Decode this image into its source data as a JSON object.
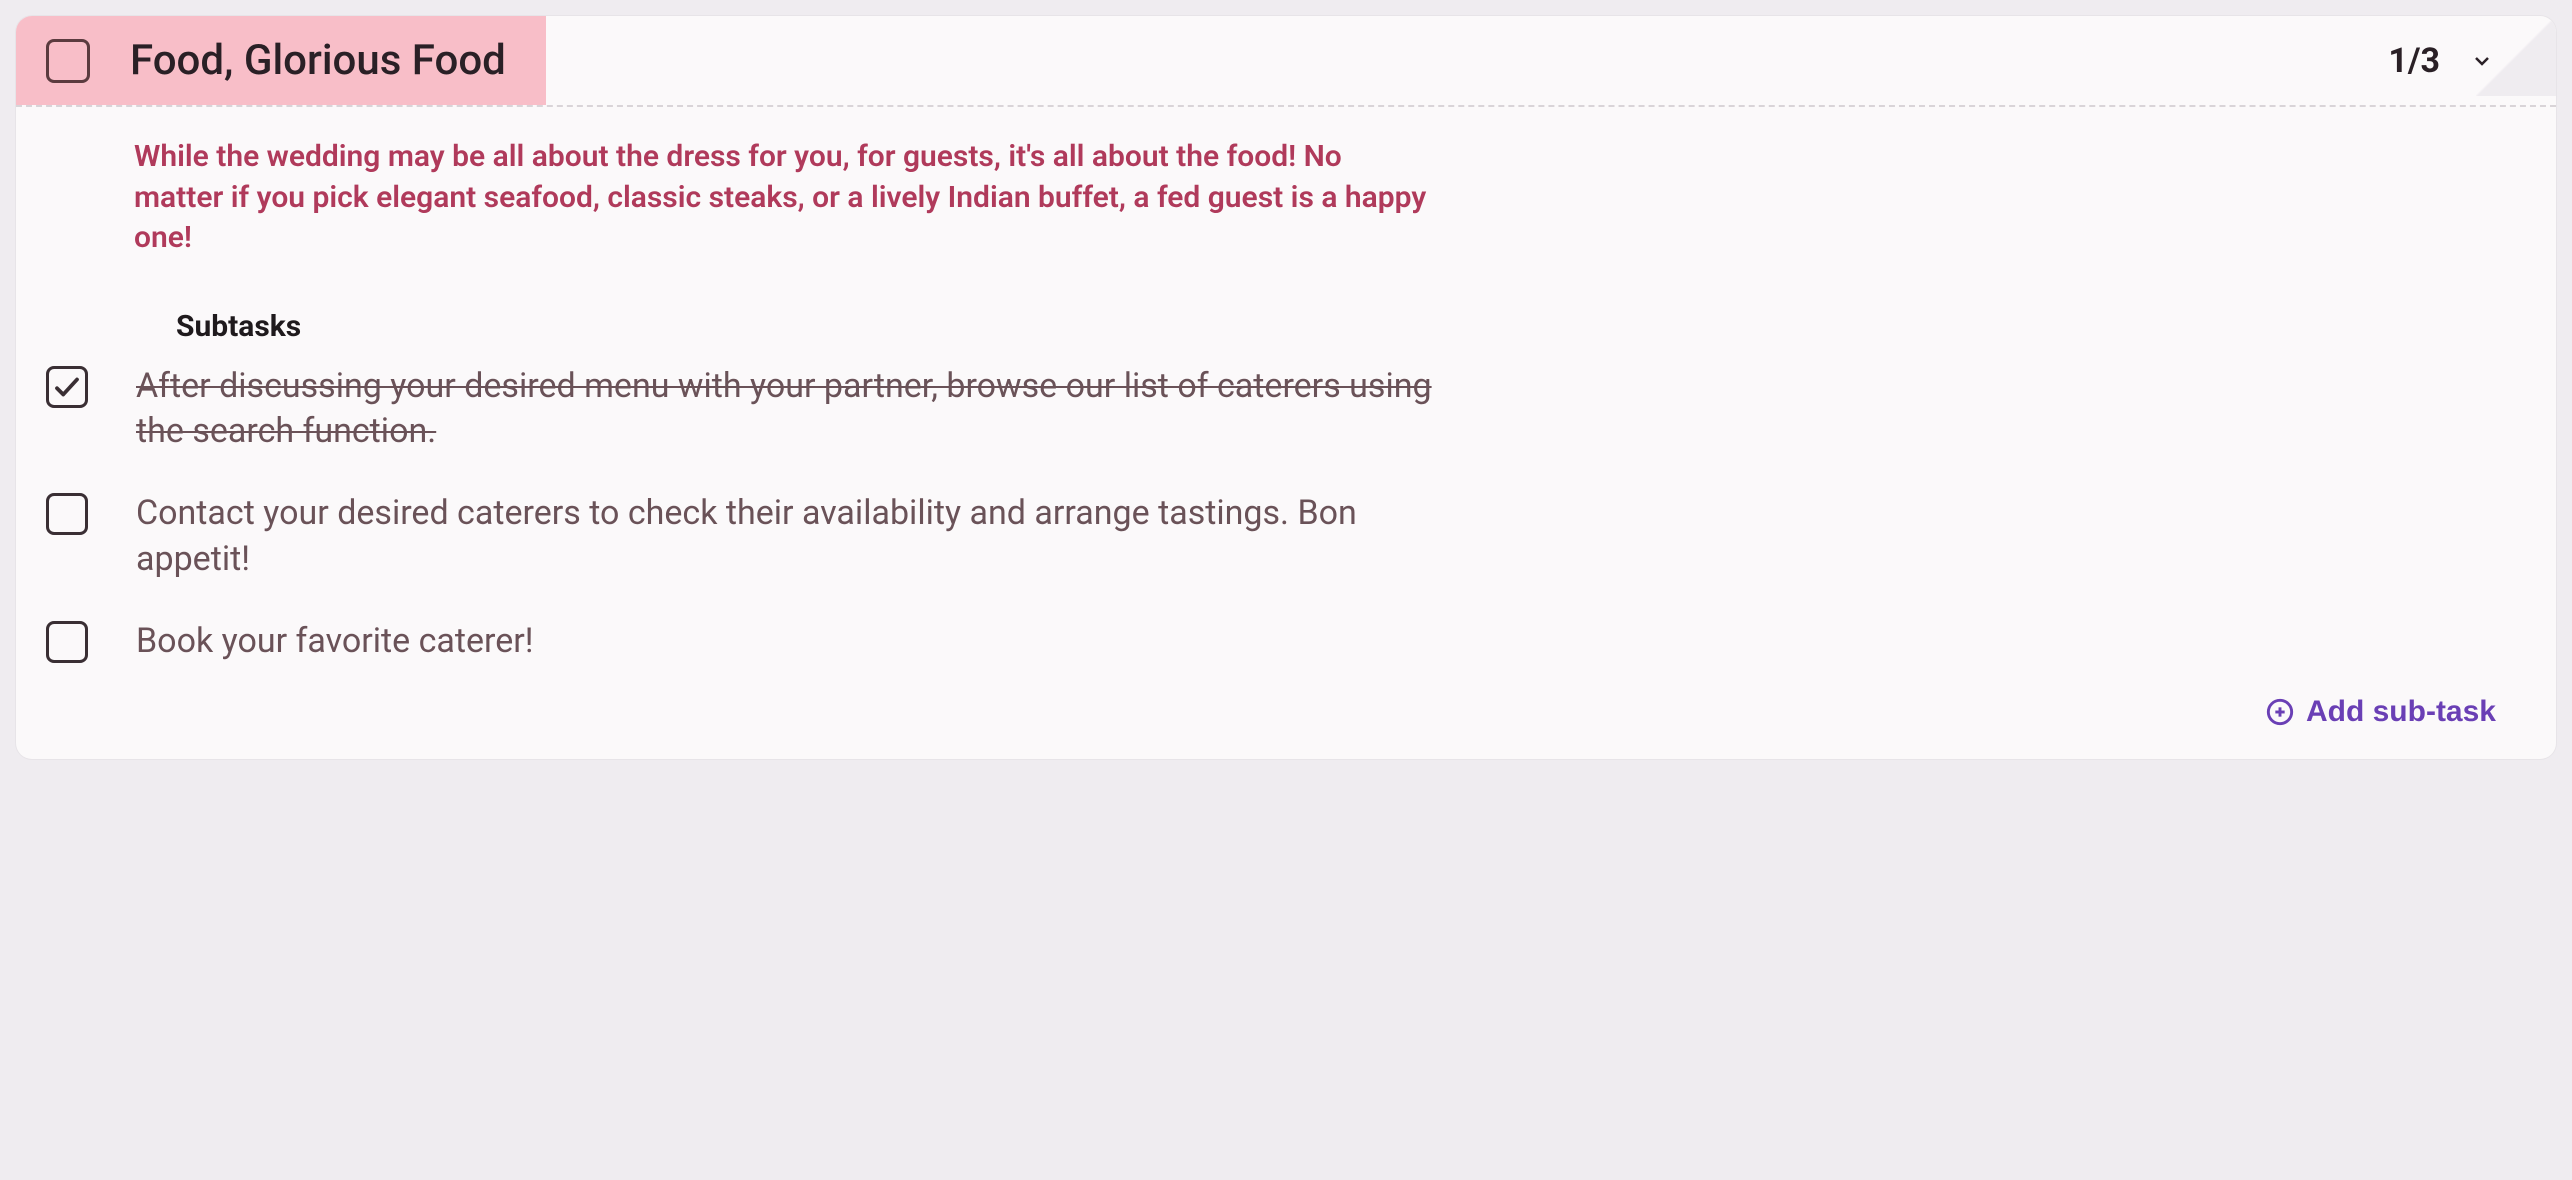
{
  "task": {
    "title": "Food, Glorious Food",
    "completed": false,
    "progress_label": "1/3",
    "description": "While the wedding may be all about the dress for you, for guests, it's all about the food! No matter if you pick elegant seafood, classic steaks, or a lively Indian buffet, a fed guest is a happy one!",
    "subtasks_heading": "Subtasks",
    "subtasks": [
      {
        "text": "After discussing your desired menu with your partner, browse our list of caterers using the search function.",
        "completed": true
      },
      {
        "text": "Contact your desired caterers to check their availability and arrange tastings. Bon appetit!",
        "completed": false
      },
      {
        "text": "Book your favorite caterer!",
        "completed": false
      }
    ],
    "add_subtask_label": "Add sub-task"
  }
}
